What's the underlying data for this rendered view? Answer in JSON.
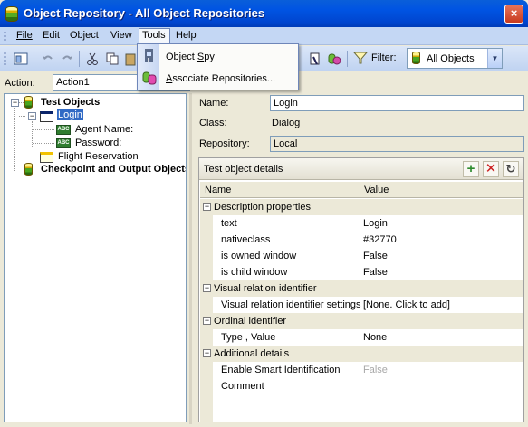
{
  "window": {
    "title": "Object Repository - All Object Repositories",
    "close_label": "×"
  },
  "menubar": {
    "file": "File",
    "edit": "Edit",
    "object": "Object",
    "view": "View",
    "tools": "Tools",
    "help": "Help"
  },
  "tools_menu": {
    "items": [
      {
        "label_pre": "Object ",
        "label_u": "S",
        "label_post": "py",
        "icon": "object-spy-icon"
      },
      {
        "label_pre": "",
        "label_u": "A",
        "label_post": "ssociate Repositories...",
        "icon": "associate-repositories-icon"
      }
    ]
  },
  "toolbar": {
    "filter_label": "Filter:",
    "filter_value": "All Objects"
  },
  "action": {
    "label": "Action:",
    "value": "Action1"
  },
  "tree": {
    "root": "Test Objects",
    "login": "Login",
    "agent_name": "Agent Name:",
    "password": "Password:",
    "flight_reservation": "Flight Reservation",
    "checkpoint_root": "Checkpoint and Output Objects"
  },
  "properties": {
    "name_label": "Name:",
    "name_value": "Login",
    "class_label": "Class:",
    "class_value": "Dialog",
    "repository_label": "Repository:",
    "repository_value": "Local"
  },
  "details": {
    "title": "Test object details",
    "col_name": "Name",
    "col_value": "Value",
    "rows": [
      {
        "type": "cat",
        "name": "Description properties"
      },
      {
        "type": "prop",
        "name": "text",
        "value": "Login"
      },
      {
        "type": "prop",
        "name": "nativeclass",
        "value": "#32770"
      },
      {
        "type": "prop",
        "name": "is owned window",
        "value": "False"
      },
      {
        "type": "prop",
        "name": "is child window",
        "value": "False"
      },
      {
        "type": "cat",
        "name": "Visual relation identifier"
      },
      {
        "type": "prop",
        "name": "Visual relation identifier settings",
        "value": "[None. Click to add]"
      },
      {
        "type": "cat",
        "name": "Ordinal identifier"
      },
      {
        "type": "prop",
        "name": "Type , Value",
        "value": "None"
      },
      {
        "type": "cat",
        "name": "Additional details"
      },
      {
        "type": "prop",
        "name": "Enable Smart Identification",
        "value": "False"
      },
      {
        "type": "prop",
        "name": "Comment",
        "value": ""
      }
    ]
  }
}
